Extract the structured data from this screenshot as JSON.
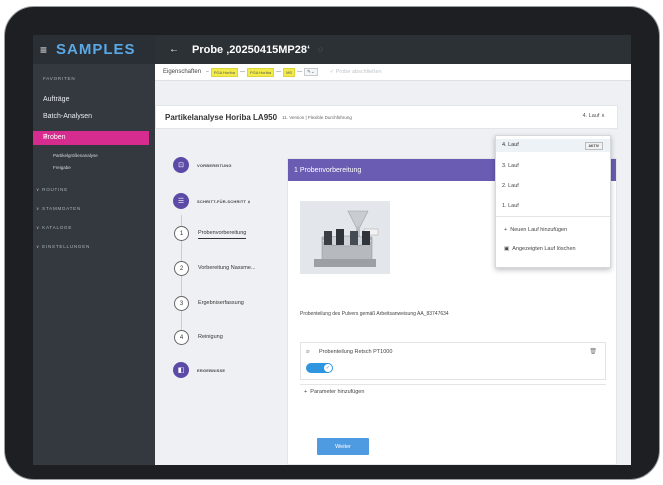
{
  "sidebar": {
    "logo": "SAMPLES",
    "favorites_label": "FAVORITEN",
    "items": [
      {
        "label": "Aufträge"
      },
      {
        "label": "Batch-Analysen"
      },
      {
        "label": "Proben"
      }
    ],
    "sub_items": [
      {
        "label": "Partikelgrößenanalyse"
      },
      {
        "label": "Freigabe"
      }
    ],
    "groups": [
      {
        "label": "ROUTINE"
      },
      {
        "label": "STAMMDATEN"
      },
      {
        "label": "KATALOGE"
      },
      {
        "label": "EINSTELLUNGEN"
      }
    ]
  },
  "header": {
    "title": "Probe ‚20250415MP28‘"
  },
  "tabbar": {
    "main_tab": "Eigenschaften",
    "chips": [
      "PGA Horiba",
      "PGA Horiba",
      "MS"
    ],
    "finish_label": "Probe abschließen"
  },
  "analysis": {
    "title": "Partikelanalyse Horiba LA950",
    "version": "11. Version | Flexible Durchführung",
    "selected_run": "4. Lauf"
  },
  "steps": {
    "vorbereitung": "VORBEREITUNG",
    "schritt": "SCHRITT-FÜR-SCHRITT",
    "ergebnisse": "ERGEBNISSE",
    "items": [
      {
        "num": "1",
        "label": "Probenvorbereitung"
      },
      {
        "num": "2",
        "label": "Vorbereitung Nassme..."
      },
      {
        "num": "3",
        "label": "Ergebniserfassung"
      },
      {
        "num": "4",
        "label": "Reinigung"
      }
    ]
  },
  "panel": {
    "heading": "1   Probenvorbereitung",
    "caption": "Probenteilung des Pulvers gemäß Arbeitsanweisung AA_83747634",
    "device": "Probenteilung Retsch PT1000",
    "add_parameter": "Parameter hinzufügen",
    "next_button": "Weiter"
  },
  "dropdown": {
    "runs": [
      {
        "label": "4. Lauf",
        "badge": "AKTIV"
      },
      {
        "label": "3. Lauf"
      },
      {
        "label": "2. Lauf"
      },
      {
        "label": "1. Lauf"
      }
    ],
    "add_run": "Neuen Lauf hinzufügen",
    "delete_run": "Angezeigten Lauf löschen"
  }
}
